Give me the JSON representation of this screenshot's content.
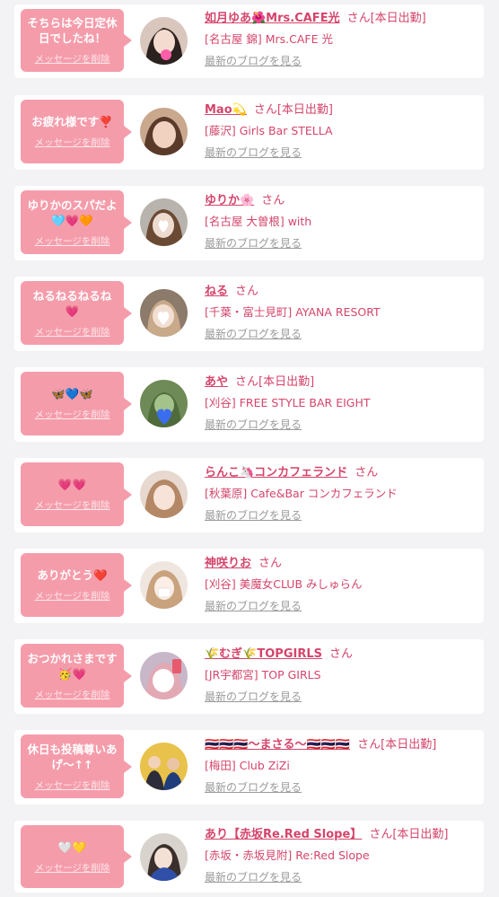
{
  "delete_label": "メッセージを削除",
  "blog_label": "最新のブログを見る",
  "san_label": "さん",
  "working_label": "[本日出勤]",
  "colors": {
    "accent": "#d4456b",
    "bubble": "#f59cab",
    "background": "#f3f3f5"
  },
  "cards": [
    {
      "message": "そちらは今日定休日でしたね！",
      "name": "如月ゆあ🌺Mrs.CAFE光",
      "working": true,
      "shop": "[名古屋 錦] Mrs.CAFE 光"
    },
    {
      "message": "お疲れ様です❣️",
      "name": "Mao💫",
      "working": true,
      "shop": "[藤沢] Girls Bar STELLA"
    },
    {
      "message": "ゆりかのスパだよ🩵💗🧡",
      "name": "ゆりか🌸",
      "working": false,
      "shop": "[名古屋 大曽根] with"
    },
    {
      "message": "ねるねるねるね💗",
      "name": "ねる",
      "working": false,
      "shop": "[千葉・富士見町] AYANA RESORT"
    },
    {
      "message": "🦋💙🦋",
      "name": "あや",
      "working": true,
      "shop": "[刈谷] FREE STYLE BAR EIGHT"
    },
    {
      "message": "💗💗",
      "name": "らんこ🦄コンカフェランド",
      "working": false,
      "shop": "[秋葉原] Cafe&Bar コンカフェランド"
    },
    {
      "message": "ありがとう❤️",
      "name": "神咲りお",
      "working": false,
      "shop": "[刈谷] 美魔女CLUB みしゅらん"
    },
    {
      "message": "おつかれさまです🥳💗",
      "name": "🌾むぎ🌾TOPGIRLS",
      "working": false,
      "shop": "[JR宇都宮] TOP GIRLS"
    },
    {
      "message": "休日も投稿尊いあげ〜↑↑",
      "name": "🇹🇭🇹🇭🇹🇭〜まさる〜🇹🇭🇹🇭🇹🇭",
      "working": true,
      "shop": "[梅田] Club ZiZi"
    },
    {
      "message": "🤍💛",
      "name": "あり【赤坂Re.Red Slope】",
      "working": true,
      "shop": "[赤坂・赤坂見附] Re:Red Slope"
    }
  ]
}
